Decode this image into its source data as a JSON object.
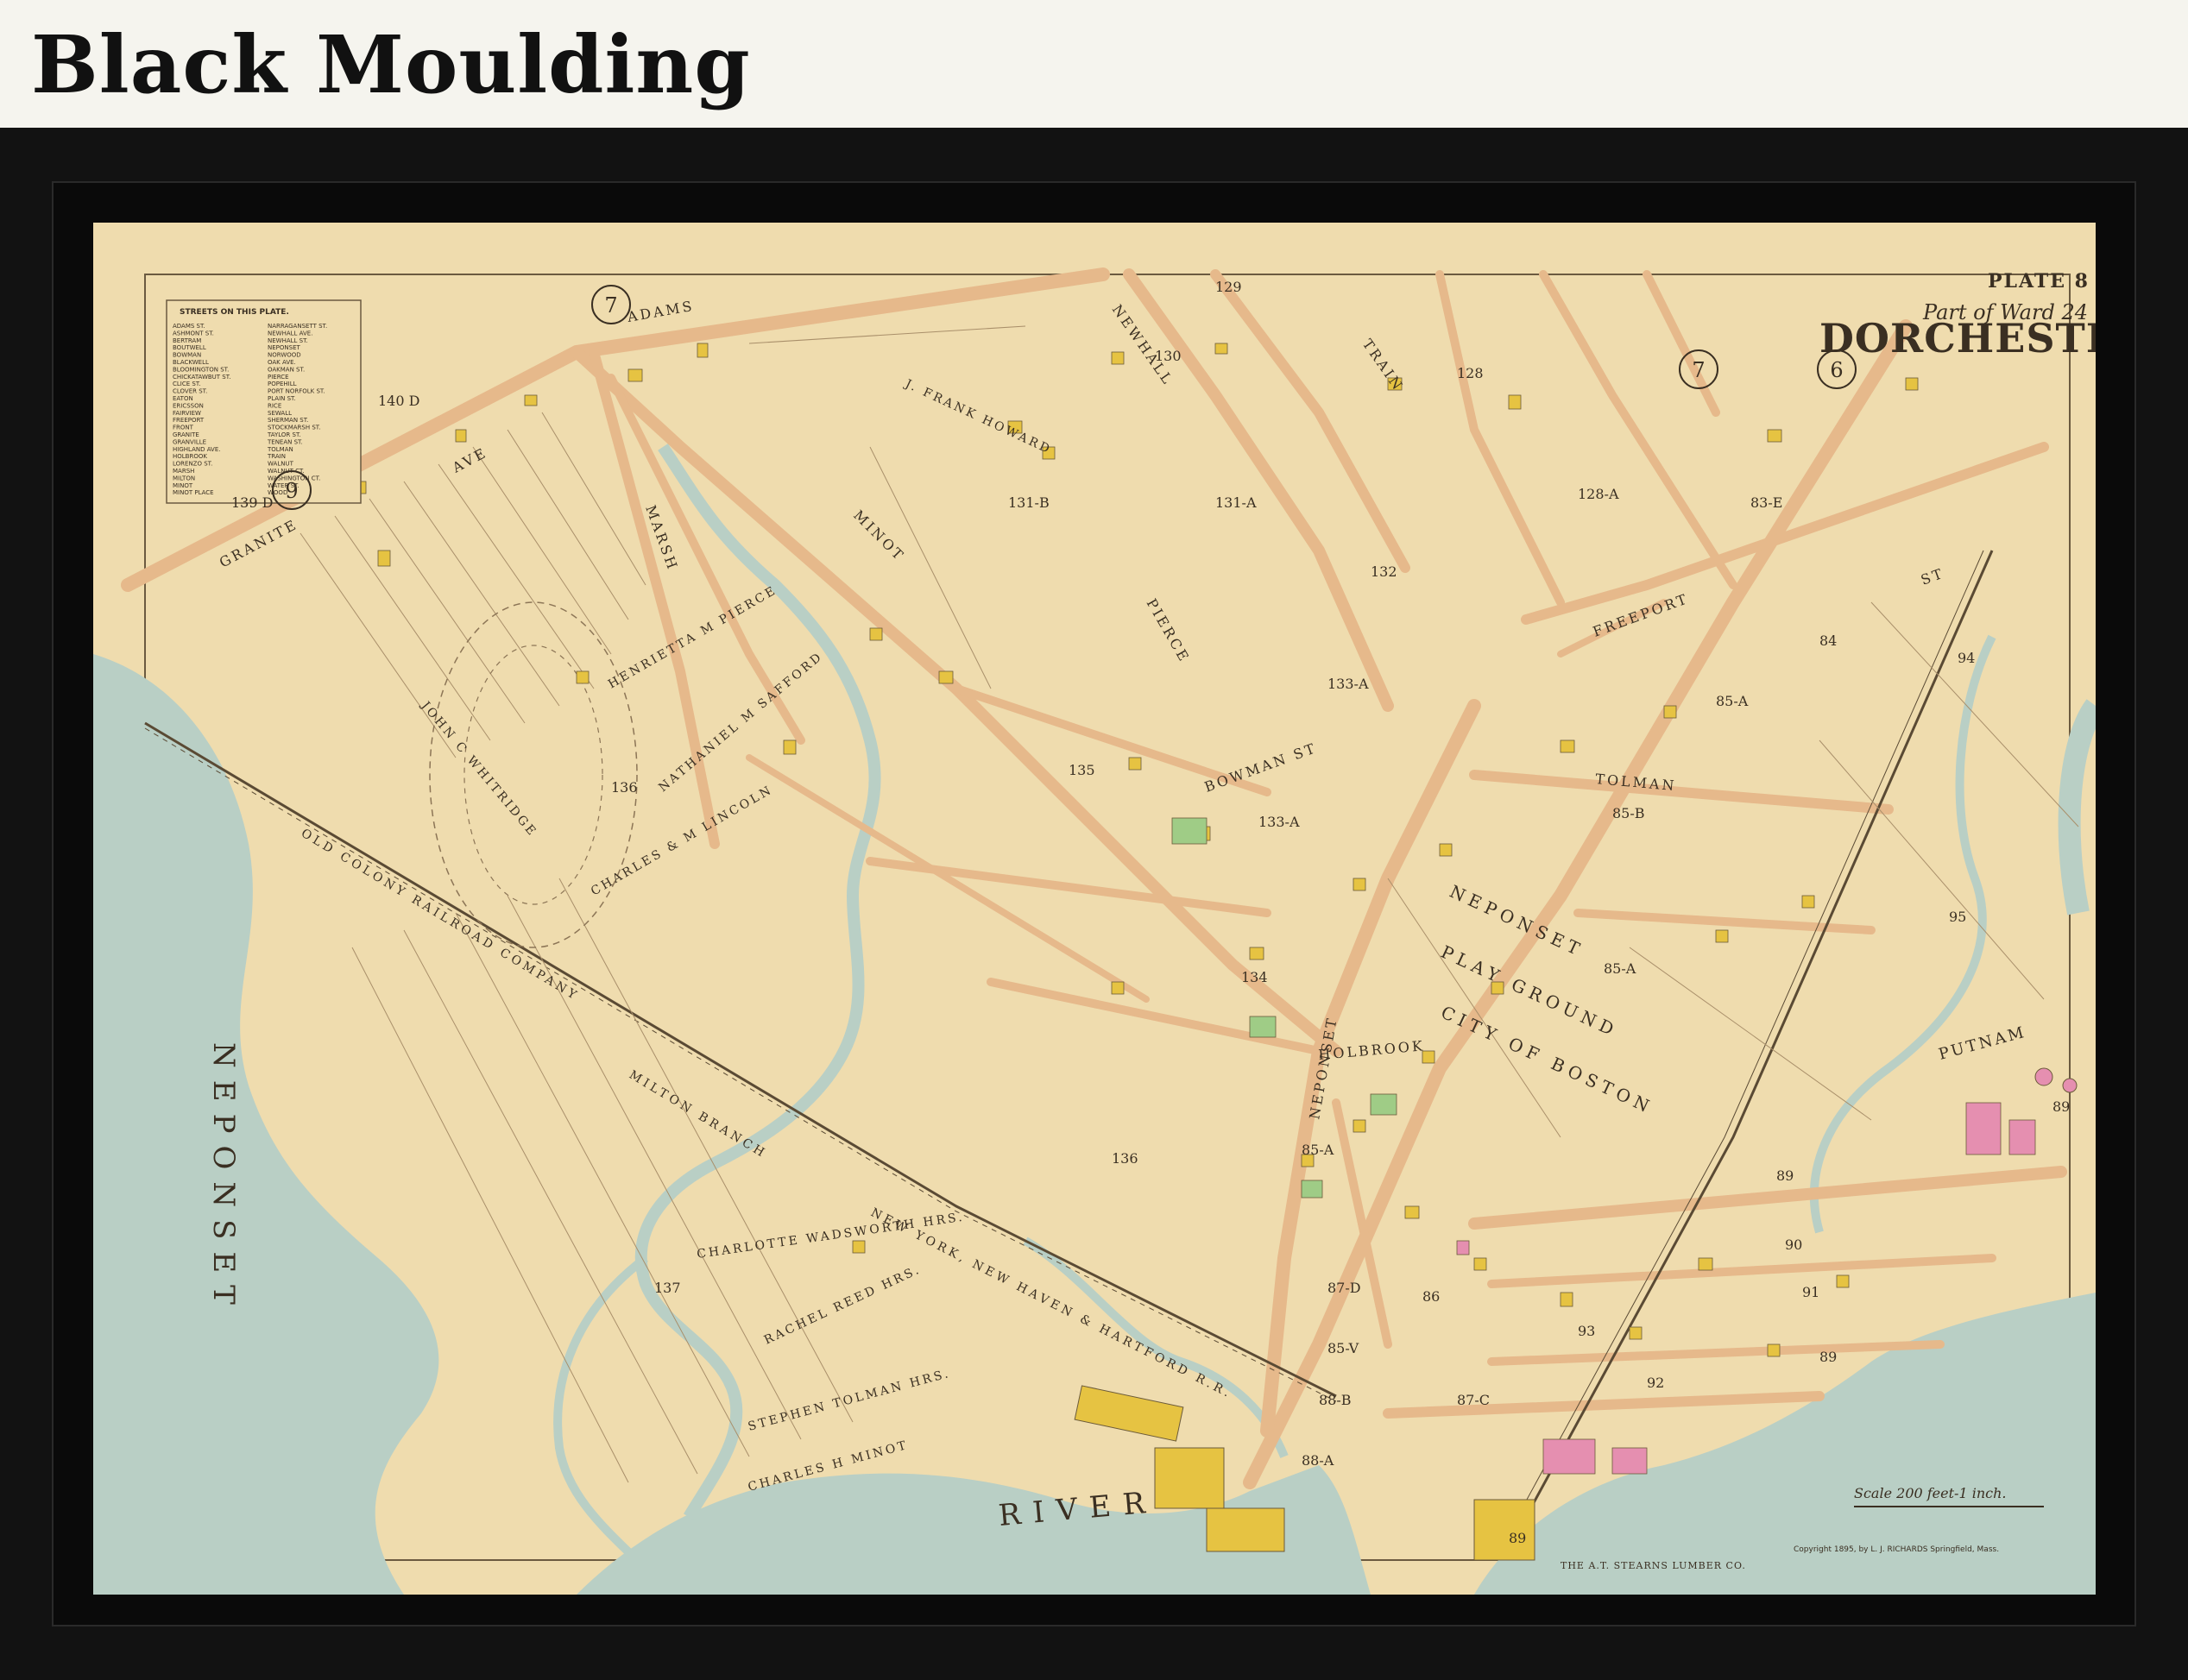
{
  "header": {
    "title": "Black Moulding"
  },
  "map": {
    "plate": "PLATE 8",
    "ward": "Part of Ward 24",
    "town": "DORCHESTER",
    "streets_heading": "STREETS ON THIS PLATE.",
    "river_label_vertical": "NEPONSET",
    "river_label_horizontal": "RIVER",
    "playground": [
      "NEPONSET",
      "PLAY GROUND",
      "CITY OF BOSTON"
    ],
    "railroad": "OLD COLONY RAILROAD COMPANY",
    "branch": "MILTON BRANCH",
    "rr_name": "NEW YORK, NEW HAVEN & HARTFORD R.R.",
    "streets": {
      "adams": "ADAMS",
      "granite": "GRANITE",
      "minot": "MINOT",
      "marsh": "MARSH",
      "newhall": "NEWHALL",
      "train": "TRAIN",
      "freeport": "FREEPORT",
      "neponset_ave": "NEPONSET",
      "holbrook": "HOLBROOK",
      "bowman": "BOWMAN ST",
      "tolman": "TOLMAN",
      "pierce": "PIERCE",
      "ave": "AVE",
      "st": "ST"
    },
    "owners": {
      "whitridge": "JOHN C WHITRIDGE",
      "pierce": "HENRIETTA M PIERCE",
      "safford": "NATHANIEL M SAFFORD",
      "lincoln": "CHARLES & M LINCOLN",
      "howard": "J. FRANK HOWARD",
      "wadsworth": "CHARLOTTE WADSWORTH HRS.",
      "tolman": "STEPHEN TOLMAN HRS.",
      "minot": "CHARLES H MINOT",
      "reed": "RACHEL REED HRS.",
      "stearns": "THE A.T. STEARNS LUMBER CO.",
      "putnam": "PUTNAM"
    },
    "lots": [
      "7",
      "7",
      "6",
      "9",
      "140 D",
      "139 D",
      "129",
      "130",
      "128",
      "128-A",
      "131-B",
      "131-A",
      "83-E",
      "132",
      "133-A",
      "133-A",
      "84",
      "94",
      "85-A",
      "85-B",
      "136",
      "135",
      "134",
      "85-A",
      "95",
      "85-A",
      "89",
      "89",
      "90",
      "91",
      "93",
      "92",
      "89",
      "136",
      "137",
      "87-D",
      "86",
      "85-V",
      "88-B",
      "88-A",
      "87-C",
      "89"
    ],
    "scale": "Scale 200 feet-1 inch.",
    "copyright": "Copyright 1895, by L. J. RICHARDS Springfield, Mass.",
    "street_list": [
      "ADAMS ST.",
      "ASHMONT ST.",
      "BERTRAM",
      "BOUTWELL",
      "BOWMAN",
      "BLACKWELL",
      "BLOOMINGTON ST.",
      "CHICKATAWBUT ST.",
      "CLICE ST.",
      "CLOVER ST.",
      "EATON",
      "ERICSSON",
      "FAIRVIEW",
      "FREEPORT",
      "FRONT",
      "GRANITE",
      "GRANVILLE",
      "HIGHLAND AVE.",
      "HOLBROOK",
      "LORENZO ST.",
      "MARSH",
      "MILTON",
      "MINOT",
      "MINOT PLACE",
      "NARRAGANSETT ST.",
      "NEWHALL AVE.",
      "NEWHALL ST.",
      "NEPONSET",
      "NORWOOD",
      "OAK AVE.",
      "OAKMAN ST.",
      "PIERCE",
      "POPEHILL",
      "PORT NORFOLK ST.",
      "PLAIN ST.",
      "RICE",
      "SEWALL",
      "SHERMAN ST.",
      "STOCKMARSH ST.",
      "TAYLOR ST.",
      "TENEAN ST.",
      "TOLMAN",
      "TRAIN",
      "WALNUT",
      "WALNUT CT.",
      "WASHINGTON CT.",
      "WATER ST.",
      "WOOD"
    ],
    "colors": {
      "paper": "#efdcae",
      "water": "#b9cfc5",
      "street": "#e6b98b",
      "building_yellow": "#e6c342",
      "building_pink": "#e58fb0",
      "building_green": "#9fcc86"
    }
  }
}
